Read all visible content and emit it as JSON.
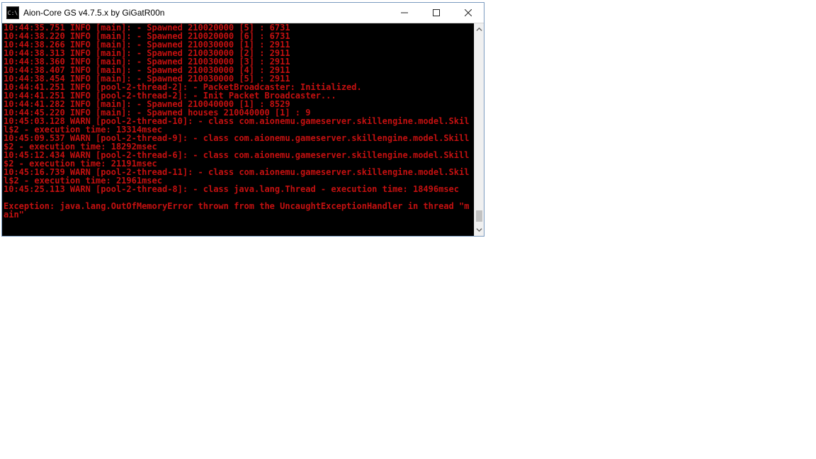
{
  "window": {
    "title": "Aion-Core GS v4.7.5.x by GiGatR00n",
    "icon_label": "C:\\"
  },
  "controls": {
    "min": "minimize",
    "max": "maximize",
    "close": "close"
  },
  "scrollbar": {
    "thumb_top_pct": 93,
    "thumb_height_pct": 6
  },
  "console_lines": [
    "10:44:35.751 INFO [main]: - Spawned 210020000 [5] : 6731",
    "10:44:38.220 INFO [main]: - Spawned 210020000 [6] : 6731",
    "10:44:38.266 INFO [main]: - Spawned 210030000 [1] : 2911",
    "10:44:38.313 INFO [main]: - Spawned 210030000 [2] : 2911",
    "10:44:38.360 INFO [main]: - Spawned 210030000 [3] : 2911",
    "10:44:38.407 INFO [main]: - Spawned 210030000 [4] : 2911",
    "10:44:38.454 INFO [main]: - Spawned 210030000 [5] : 2911",
    "10:44:41.251 INFO [pool-2-thread-2]: - PacketBroadcaster: Initialized.",
    "10:44:41.251 INFO [pool-2-thread-2]: - Init Packet Broadcaster...",
    "10:44:41.282 INFO [main]: - Spawned 210040000 [1] : 8529",
    "10:44:45.220 INFO [main]: - Spawned houses 210040000 [1] : 9",
    "10:45:03.128 WARN [pool-2-thread-10]: - class com.aionemu.gameserver.skillengine.model.Skill$2 - execution time: 13314msec",
    "10:45:09.537 WARN [pool-2-thread-9]: - class com.aionemu.gameserver.skillengine.model.Skill$2 - execution time: 18292msec",
    "10:45:12.434 WARN [pool-2-thread-6]: - class com.aionemu.gameserver.skillengine.model.Skill$2 - execution time: 21191msec",
    "10:45:16.739 WARN [pool-2-thread-11]: - class com.aionemu.gameserver.skillengine.model.Skill$2 - execution time: 21961msec",
    "10:45:25.113 WARN [pool-2-thread-8]: - class java.lang.Thread - execution time: 18496msec",
    "",
    "Exception: java.lang.OutOfMemoryError thrown from the UncaughtExceptionHandler in thread \"main\""
  ]
}
